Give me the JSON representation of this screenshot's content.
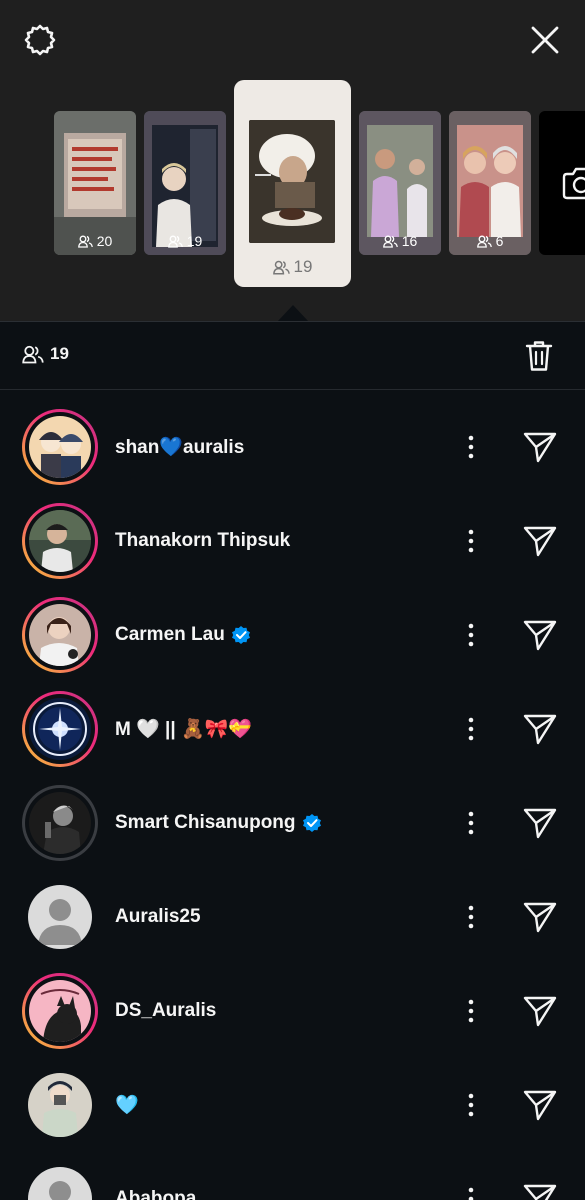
{
  "header": {
    "settings_icon": "gear-icon",
    "close_icon": "close-icon"
  },
  "stories": [
    {
      "count": "20",
      "bg": "#6f6f6f"
    },
    {
      "count": "19",
      "bg": "#5e5a66"
    },
    {
      "count": "19",
      "bg": "#eeeae5",
      "selected": true
    },
    {
      "count": "16",
      "bg": "#6b6470"
    },
    {
      "count": "6",
      "bg": "#7a6f70"
    }
  ],
  "camera_icon": "camera-icon",
  "viewers": {
    "count": "19",
    "icon": "people-icon",
    "trash_icon": "trash-icon"
  },
  "rows": [
    {
      "name": "shan💙auralis",
      "verified": false,
      "ring": "gradient",
      "avatar_color": "#f3d7b0"
    },
    {
      "name": "Thanakorn Thipsuk",
      "verified": false,
      "ring": "gradient",
      "avatar_color": "#3c4a3f"
    },
    {
      "name": "Carmen Lau",
      "verified": true,
      "ring": "gradient",
      "avatar_color": "#c9b3a8"
    },
    {
      "name": "M 🤍 || 🧸🎀💝",
      "verified": false,
      "ring": "gradient",
      "avatar_color": "#0a1a3a"
    },
    {
      "name": "Smart Chisanupong",
      "verified": true,
      "ring": "gray",
      "avatar_color": "#1b1b1b"
    },
    {
      "name": "Auralis25",
      "verified": false,
      "ring": "none",
      "avatar_color": "#dbdbdb"
    },
    {
      "name": "DS_Auralis",
      "verified": false,
      "ring": "gradient",
      "avatar_color": "#f6b6c4"
    },
    {
      "name": "🩵",
      "verified": false,
      "ring": "none",
      "avatar_color": "#d6d2c8"
    },
    {
      "name": "Ababopa",
      "verified": false,
      "ring": "none",
      "avatar_color": "#dbdbdb"
    }
  ],
  "row_icons": {
    "more": "more-vertical-icon",
    "send": "send-icon",
    "verified": "verified-badge-icon"
  },
  "colors": {
    "accent": "#0095f6",
    "background": "#0c1014",
    "top_background": "#1f1f1f"
  }
}
